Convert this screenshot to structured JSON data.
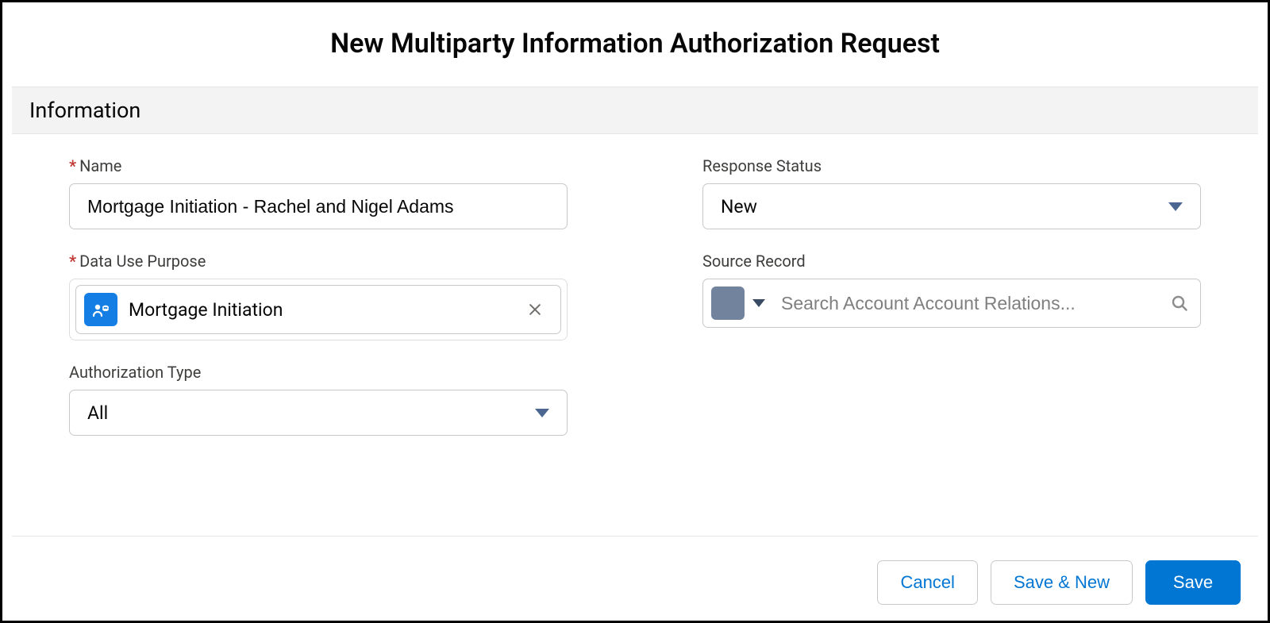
{
  "dialog": {
    "title": "New Multiparty Information Authorization Request",
    "section_label": "Information"
  },
  "fields": {
    "name": {
      "label": "Name",
      "required_marker": "*",
      "value": "Mortgage Initiation - Rachel and Nigel Adams"
    },
    "data_use_purpose": {
      "label": "Data Use Purpose",
      "required_marker": "*",
      "selected": "Mortgage Initiation",
      "icon": "data-use-purpose-icon"
    },
    "authorization_type": {
      "label": "Authorization Type",
      "value": "All"
    },
    "response_status": {
      "label": "Response Status",
      "value": "New"
    },
    "source_record": {
      "label": "Source Record",
      "placeholder": "Search Account Account Relations..."
    }
  },
  "footer": {
    "cancel": "Cancel",
    "save_and_new": "Save & New",
    "save": "Save"
  }
}
